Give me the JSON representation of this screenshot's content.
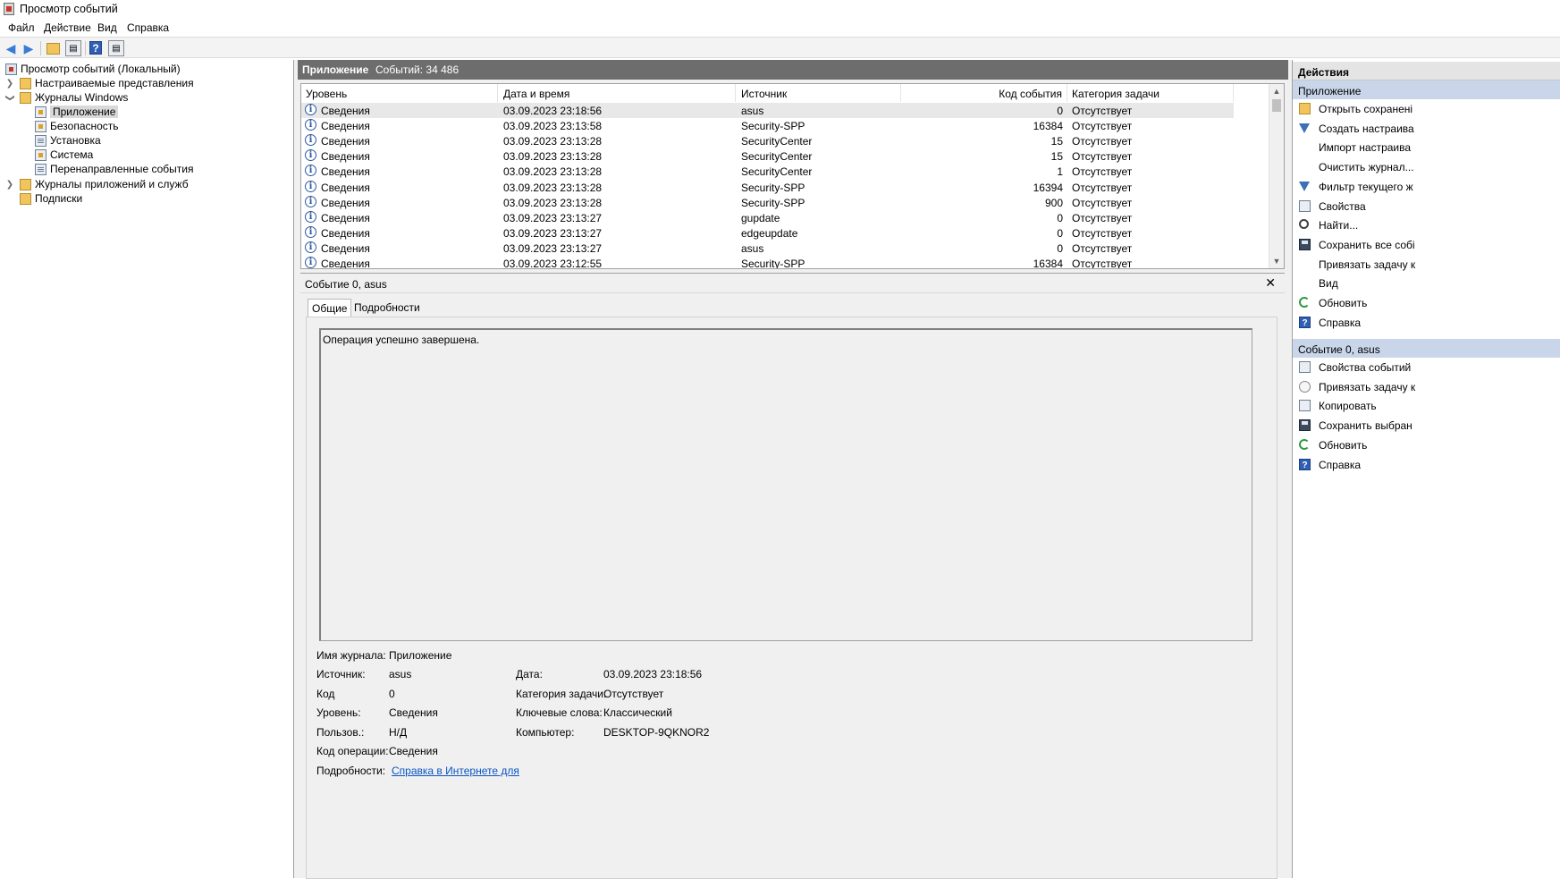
{
  "window": {
    "title": "Просмотр событий"
  },
  "menu": [
    "Файл",
    "Действие",
    "Вид",
    "Справка"
  ],
  "toolbar": {
    "icons": [
      "back-arrow-icon",
      "forward-arrow-icon",
      "open-folder-icon",
      "console-tree-icon",
      "help-icon",
      "properties-panel-icon"
    ]
  },
  "tree": {
    "root": "Просмотр событий (Локальный)",
    "custom_views": "Настраиваемые представления",
    "windows_logs": "Журналы Windows",
    "application": "Приложение",
    "security": "Безопасность",
    "setup": "Установка",
    "system": "Система",
    "forwarded": "Перенаправленные события",
    "app_services_logs": "Журналы приложений и служб",
    "subscriptions": "Подписки"
  },
  "center": {
    "log_name": "Приложение",
    "event_count": "Событий: 34 486",
    "columns": [
      "Уровень",
      "Дата и время",
      "Источник",
      "Код события",
      "Категория задачи"
    ],
    "rows": [
      {
        "level": "Сведения",
        "datetime": "03.09.2023 23:18:56",
        "source": "asus",
        "code": "0",
        "category": "Отсутствует"
      },
      {
        "level": "Сведения",
        "datetime": "03.09.2023 23:13:58",
        "source": "Security-SPP",
        "code": "16384",
        "category": "Отсутствует"
      },
      {
        "level": "Сведения",
        "datetime": "03.09.2023 23:13:28",
        "source": "SecurityCenter",
        "code": "15",
        "category": "Отсутствует"
      },
      {
        "level": "Сведения",
        "datetime": "03.09.2023 23:13:28",
        "source": "SecurityCenter",
        "code": "15",
        "category": "Отсутствует"
      },
      {
        "level": "Сведения",
        "datetime": "03.09.2023 23:13:28",
        "source": "SecurityCenter",
        "code": "1",
        "category": "Отсутствует"
      },
      {
        "level": "Сведения",
        "datetime": "03.09.2023 23:13:28",
        "source": "Security-SPP",
        "code": "16394",
        "category": "Отсутствует"
      },
      {
        "level": "Сведения",
        "datetime": "03.09.2023 23:13:28",
        "source": "Security-SPP",
        "code": "900",
        "category": "Отсутствует"
      },
      {
        "level": "Сведения",
        "datetime": "03.09.2023 23:13:27",
        "source": "gupdate",
        "code": "0",
        "category": "Отсутствует"
      },
      {
        "level": "Сведения",
        "datetime": "03.09.2023 23:13:27",
        "source": "edgeupdate",
        "code": "0",
        "category": "Отсутствует"
      },
      {
        "level": "Сведения",
        "datetime": "03.09.2023 23:13:27",
        "source": "asus",
        "code": "0",
        "category": "Отсутствует"
      },
      {
        "level": "Сведения",
        "datetime": "03.09.2023 23:12:55",
        "source": "Security-SPP",
        "code": "16384",
        "category": "Отсутствует"
      }
    ]
  },
  "detail": {
    "title": "Событие 0, asus",
    "tabs": [
      "Общие",
      "Подробности"
    ],
    "message": "Операция успешно завершена.",
    "fields": {
      "log_name_label": "Имя журнала:",
      "log_name_value": "Приложение",
      "source_label": "Источник:",
      "source_value": "asus",
      "code_label": "Код",
      "code_value": "0",
      "level_label": "Уровень:",
      "level_value": "Сведения",
      "user_label": "Пользов.:",
      "user_value": "Н/Д",
      "opcode_label": "Код операции:",
      "opcode_value": "Сведения",
      "details_label": "Подробности:",
      "details_link": "Справка в Интернете для",
      "date_label": "Дата:",
      "date_value": "03.09.2023 23:18:56",
      "task_label": "Категория задачи:",
      "task_value": "Отсутствует",
      "keywords_label": "Ключевые слова:",
      "keywords_value": "Классический",
      "computer_label": "Компьютер:",
      "computer_value": "DESKTOP-9QKNOR2"
    }
  },
  "actions": {
    "header": "Действия",
    "section1": "Приложение",
    "items1": [
      {
        "label": "Открыть сохранені",
        "icon": "open-folder-icon"
      },
      {
        "label": "Создать настраива",
        "icon": "filter-icon"
      },
      {
        "label": "Импорт настраива",
        "icon": ""
      },
      {
        "label": "Очистить журнал...",
        "icon": ""
      },
      {
        "label": "Фильтр текущего ж",
        "icon": "filter-icon"
      },
      {
        "label": "Свойства",
        "icon": "properties-icon"
      },
      {
        "label": "Найти...",
        "icon": "find-icon"
      },
      {
        "label": "Сохранить все собі",
        "icon": "save-icon"
      },
      {
        "label": "Привязать задачу к",
        "icon": ""
      },
      {
        "label": "Вид",
        "icon": ""
      },
      {
        "label": "Обновить",
        "icon": "refresh-icon"
      },
      {
        "label": "Справка",
        "icon": "help-icon"
      }
    ],
    "section2": "Событие 0, asus",
    "items2": [
      {
        "label": "Свойства событий",
        "icon": "properties-icon"
      },
      {
        "label": "Привязать задачу к",
        "icon": "task-icon"
      },
      {
        "label": "Копировать",
        "icon": "copy-icon"
      },
      {
        "label": "Сохранить выбран",
        "icon": "save-icon"
      },
      {
        "label": "Обновить",
        "icon": "refresh-icon"
      },
      {
        "label": "Справка",
        "icon": "help-icon"
      }
    ]
  }
}
